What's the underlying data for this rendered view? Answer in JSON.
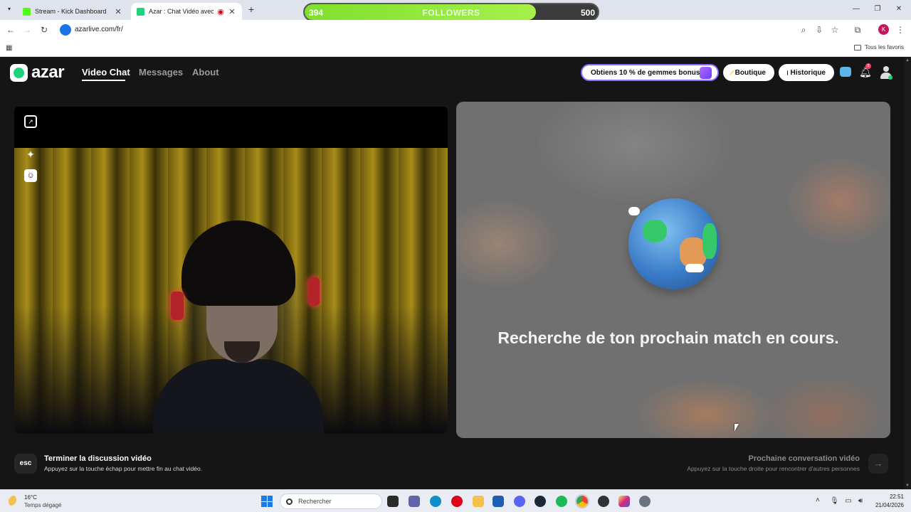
{
  "browser": {
    "tabs": [
      {
        "title": "Stream - Kick Dashboard",
        "favicon_color": "#53fc18"
      },
      {
        "title": "Azar : Chat Vidéo avec de n",
        "favicon_color": "#1ed37d"
      }
    ],
    "url": "azarlive.com/fr/",
    "profile_initial": "K",
    "bookmarks_label": "Tous les favoris"
  },
  "followers_widget": {
    "current": "394",
    "label": "FOLLOWERS",
    "goal": "500",
    "progress": 0.788
  },
  "azar": {
    "logo": "azar",
    "nav": [
      "Video Chat",
      "Messages",
      "About"
    ],
    "active_nav": "Video Chat",
    "promo": "Obtiens 10 % de gemmes bonus !",
    "shop": "Boutique",
    "history": "Historique",
    "notification_count": "3",
    "match_status": "Recherche de ton prochain match en cours.",
    "end_chat": {
      "key": "esc",
      "title": "Terminer la discussion vidéo",
      "subtitle": "Appuyez sur la touche échap pour mettre fin au chat vidéo."
    },
    "next_chat": {
      "title": "Prochaine conversation vidéo",
      "subtitle": "Appuyez sur la touche droite pour rencontrer d'autres personnes"
    }
  },
  "taskbar": {
    "temperature": "16°C",
    "weather": "Temps dégagé",
    "search_placeholder": "Rechercher",
    "time": "22:51",
    "date": "21/04/2026"
  }
}
